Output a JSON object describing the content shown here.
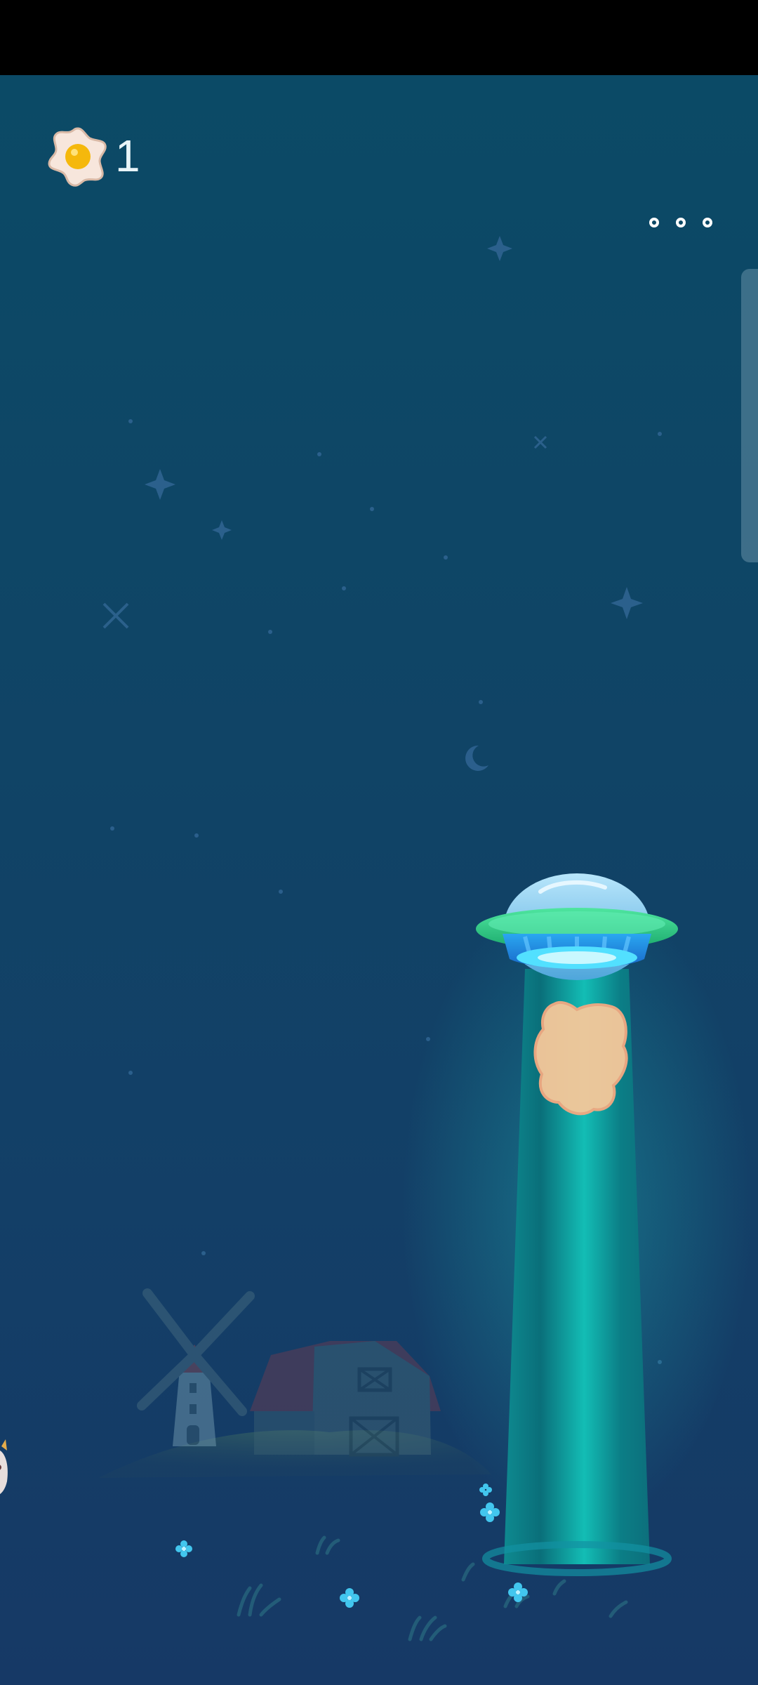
{
  "hud": {
    "score_value": "1",
    "score_icon": "fried-egg-icon",
    "menu_icon": "more-dots-icon"
  },
  "scene": {
    "setting": "night-farm",
    "objects": [
      "ufo",
      "tractor-beam",
      "abducted-creature",
      "windmill",
      "barn",
      "hill",
      "cow",
      "stars",
      "moon",
      "flowers"
    ]
  },
  "colors": {
    "sky_top": "#0b4a66",
    "sky_bottom": "#163966",
    "ufo_dome": "#7ec8ef",
    "ufo_rim": "#2fd07f",
    "ufo_base": "#1a8fe3",
    "beam": "#11b3ad",
    "creature": "#f6c89a",
    "score_text": "#e8f4f8"
  }
}
